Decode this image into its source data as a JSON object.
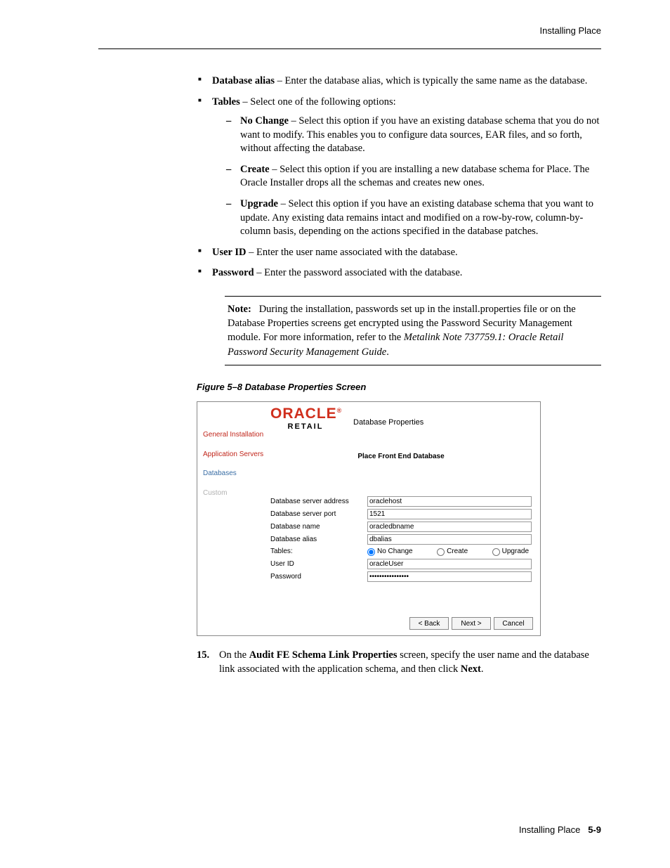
{
  "runningHead": "Installing Place",
  "bullets": {
    "dbAlias": {
      "label": "Database alias",
      "text": " – Enter the database alias, which is typically the same name as the database."
    },
    "tables": {
      "label": "Tables",
      "text": " – Select one of the following options:"
    },
    "tablesSub": [
      {
        "label": "No Change",
        "text": " – Select this option if you have an existing database schema that you do not want to modify. This enables you to configure data sources, EAR files, and so forth, without affecting the database."
      },
      {
        "label": "Create",
        "text": " – Select this option if you are installing a new database schema for Place. The Oracle Installer drops all the schemas and creates new ones."
      },
      {
        "label": "Upgrade",
        "text": " – Select this option if you have an existing database schema that you want to update. Any existing data remains intact and modified on a row-by-row, column-by-column basis, depending on the actions specified in the database patches."
      }
    ],
    "userId": {
      "label": "User ID",
      "text": " – Enter the user name associated with the database."
    },
    "password": {
      "label": "Password",
      "text": " – Enter the password associated with the database."
    }
  },
  "note": {
    "label": "Note:",
    "bodyPre": "During the installation, passwords set up in the install.properties file or on the Database Properties screens get encrypted using the Password Security Management module. For more information, refer to the ",
    "italic": "Metalink Note 737759.1: Oracle Retail Password Security Management Guide",
    "bodyPost": "."
  },
  "figureCaption": "Figure 5–8    Database Properties Screen",
  "wizard": {
    "logoText": "ORACLE",
    "logoReg": "®",
    "retail": "RETAIL",
    "title": "Database Properties",
    "subtitle": "Place Front End Database",
    "sidebar": [
      {
        "label": "General Installation",
        "cls": "side-red"
      },
      {
        "label": "Application Servers",
        "cls": "side-red"
      },
      {
        "label": "Databases",
        "cls": "side-blue"
      },
      {
        "label": "Custom",
        "cls": "side-gray"
      }
    ],
    "fields": {
      "addrLbl": "Database server address",
      "addrVal": "oraclehost",
      "portLbl": "Database server port",
      "portVal": "1521",
      "nameLbl": "Database name",
      "nameVal": "oracledbname",
      "aliasLbl": "Database alias",
      "aliasVal": "dbalias",
      "tablesLbl": "Tables:",
      "radioNoChange": "No Change",
      "radioCreate": "Create",
      "radioUpgrade": "Upgrade",
      "userLbl": "User ID",
      "userVal": "oracleUser",
      "passLbl": "Password",
      "passVal": "••••••••••••••••"
    },
    "buttons": {
      "back": "< Back",
      "next": "Next >",
      "cancel": "Cancel"
    }
  },
  "step15": {
    "num": "15.",
    "pre": "On the ",
    "b1": "Audit FE Schema Link Properties",
    "mid": " screen, specify the user name and the database link associated with the application schema, and then click ",
    "b2": "Next",
    "post": "."
  },
  "footer": {
    "text": "Installing Place",
    "page": "5-9"
  }
}
